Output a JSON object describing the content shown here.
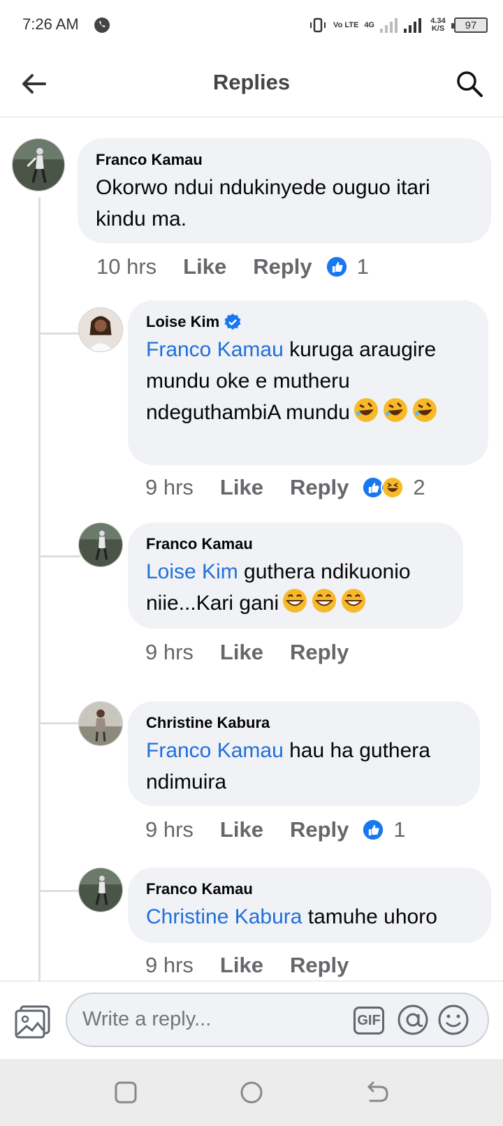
{
  "status_bar": {
    "time": "7:26 AM",
    "volte": "Vo LTE",
    "network": "4G",
    "speed": "4.34 K/S",
    "battery": "97"
  },
  "header": {
    "title": "Replies"
  },
  "comments": [
    {
      "author": "Franco Kamau",
      "text": "Okorwo ndui ndukinyede ouguo itari kindu ma.",
      "time": "10 hrs",
      "like_label": "Like",
      "reply_label": "Reply",
      "reaction_count": "1",
      "reactions": [
        "like"
      ]
    },
    {
      "author": "Loise Kim",
      "verified": true,
      "mention": "Franco Kamau",
      "text": " kuruga araugire mundu oke e mutheru ndeguthambiA mundu",
      "emoji_suffix": [
        "rofl",
        "rofl",
        "rofl"
      ],
      "time": "9 hrs",
      "like_label": "Like",
      "reply_label": "Reply",
      "reaction_count": "2",
      "reactions": [
        "like",
        "haha"
      ]
    },
    {
      "author": "Franco Kamau",
      "mention": "Loise Kim",
      "text": " guthera ndikuonio niie...Kari gani",
      "emoji_suffix": [
        "grin",
        "grin",
        "grin"
      ],
      "time": "9 hrs",
      "like_label": "Like",
      "reply_label": "Reply"
    },
    {
      "author": "Christine Kabura",
      "mention": "Franco Kamau",
      "text": " hau ha guthera ndimuira",
      "time": "9 hrs",
      "like_label": "Like",
      "reply_label": "Reply",
      "reaction_count": "1",
      "reactions": [
        "like"
      ]
    },
    {
      "author": "Franco Kamau",
      "mention": "Christine Kabura",
      "text": " tamuhe uhoro",
      "time": "9 hrs",
      "like_label": "Like",
      "reply_label": "Reply"
    }
  ],
  "composer": {
    "placeholder": "Write a reply...",
    "gif_label": "GIF"
  },
  "colors": {
    "mention": "#216fdb",
    "like_blue": "#1877f2",
    "bubble_bg": "#f0f2f5"
  }
}
